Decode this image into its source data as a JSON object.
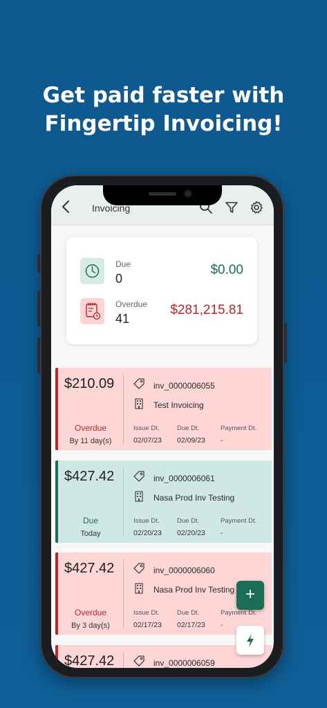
{
  "headline": {
    "line1": "Get paid faster with",
    "line2": "Fingertip Invoicing!"
  },
  "appbar": {
    "title": "Invoicing"
  },
  "summary": {
    "due": {
      "label": "Due",
      "count": "0",
      "amount": "$0.00"
    },
    "overdue": {
      "label": "Overdue",
      "count": "41",
      "amount": "$281,215.81"
    }
  },
  "column_headers": {
    "issue": "Issue Dt.",
    "due": "Due Dt.",
    "payment": "Payment Dt."
  },
  "invoices": [
    {
      "amount": "$210.09",
      "status": "Overdue",
      "sub": "By 11 day(s)",
      "id": "inv_0000006055",
      "client": "Test Invoicing",
      "issue": "02/07/23",
      "due": "02/09/23",
      "payment": "-"
    },
    {
      "amount": "$427.42",
      "status": "Due",
      "sub": "Today",
      "id": "inv_0000006061",
      "client": "Nasa Prod Inv Testing",
      "issue": "02/20/23",
      "due": "02/20/23",
      "payment": "-"
    },
    {
      "amount": "$427.42",
      "status": "Overdue",
      "sub": "By 3 day(s)",
      "id": "inv_0000006060",
      "client": "Nasa Prod Inv Testing",
      "issue": "02/17/23",
      "due": "02/17/23",
      "payment": "-"
    },
    {
      "amount": "$427.42",
      "id": "inv_0000006059"
    }
  ],
  "fab": {
    "add_label": "+"
  },
  "colors": {
    "overdue": "#b3272d",
    "due": "#1e6d55",
    "accent": "#1b6d55",
    "background": "#0e5a8f"
  },
  "icons": [
    "back-arrow-icon",
    "search-icon",
    "filter-icon",
    "gear-icon",
    "clock-icon",
    "overdue-calendar-icon",
    "tag-icon",
    "building-icon",
    "lightning-icon"
  ]
}
